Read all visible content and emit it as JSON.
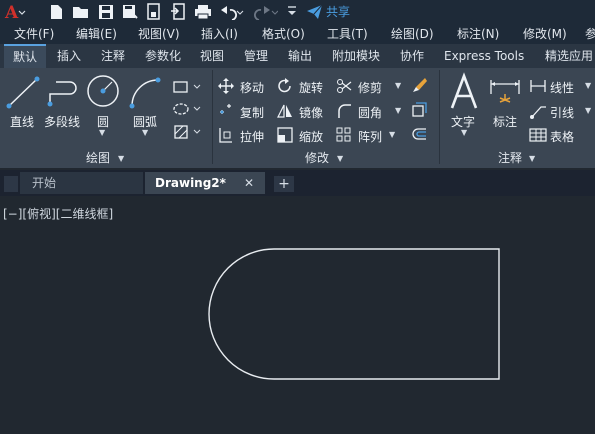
{
  "title_bar": {
    "share_label": "共享"
  },
  "menu": {
    "items": [
      "文件(F)",
      "编辑(E)",
      "视图(V)",
      "插入(I)",
      "格式(O)",
      "工具(T)",
      "绘图(D)",
      "标注(N)",
      "修改(M)",
      "参"
    ]
  },
  "ribbon_tabs": [
    "默认",
    "插入",
    "注释",
    "参数化",
    "视图",
    "管理",
    "输出",
    "附加模块",
    "协作",
    "Express Tools",
    "精选应用"
  ],
  "ribbon": {
    "draw_panel": {
      "title": "绘图",
      "line": "直线",
      "polyline": "多段线",
      "circle": "圆",
      "arc": "圆弧"
    },
    "modify_panel": {
      "title": "修改",
      "move": "移动",
      "rotate": "旋转",
      "trim": "修剪",
      "copy": "复制",
      "mirror": "镜像",
      "fillet": "圆角",
      "stretch": "拉伸",
      "scale": "缩放",
      "array": "阵列"
    },
    "annotation_panel": {
      "title": "注释",
      "text": "文字",
      "dimension": "标注",
      "linear": "线性",
      "leader": "引线",
      "table": "表格"
    }
  },
  "doc_tabs": {
    "start": "开始",
    "drawing": "Drawing2*"
  },
  "viewport": {
    "label": "[−][俯视][二维线框]"
  },
  "colors": {
    "accent_red": "#d0302b",
    "share_blue": "#4a9de0",
    "ribbon_bg": "#3b4653",
    "canvas_bg": "#212830"
  }
}
